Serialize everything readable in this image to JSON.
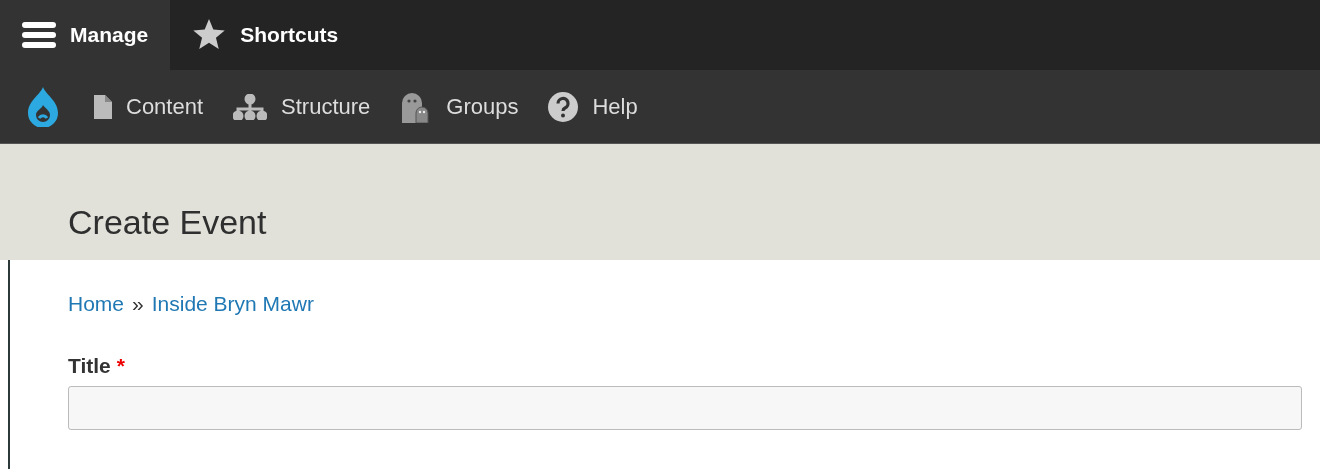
{
  "toolbar": {
    "tabs": [
      {
        "label": "Manage",
        "kind": "menu",
        "selected": true
      },
      {
        "label": "Shortcuts",
        "kind": "star",
        "selected": false
      }
    ]
  },
  "tray": {
    "items": [
      {
        "label": "Content",
        "kind": "file"
      },
      {
        "label": "Structure",
        "kind": "sitemap"
      },
      {
        "label": "Groups",
        "kind": "groups"
      },
      {
        "label": "Help",
        "kind": "help"
      }
    ]
  },
  "page_title": "Create Event",
  "breadcrumb": {
    "links": [
      "Home",
      "Inside Bryn Mawr"
    ],
    "separator": "»"
  },
  "form": {
    "required_marker": "*",
    "fields": [
      {
        "label": "Title",
        "required": true
      }
    ]
  }
}
